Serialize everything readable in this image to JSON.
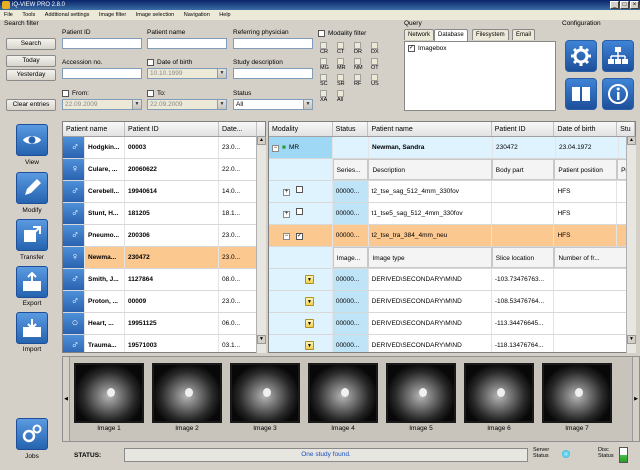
{
  "window": {
    "title": "iQ-VIEW PRO 2.8.0"
  },
  "menu": [
    "File",
    "Tools",
    "Additional settings",
    "Image filter",
    "Image selection",
    "Navigation",
    "Help"
  ],
  "search": {
    "group_label": "Search filter",
    "buttons": {
      "search": "Search",
      "today": "Today",
      "yesterday": "Yesterday",
      "clear": "Clear entries"
    },
    "labels": {
      "patient_id": "Patient ID",
      "patient_name": "Patient name",
      "referring_physician": "Referring physician",
      "accession_no": "Accession no.",
      "date_of_birth": "Date of birth",
      "study_description": "Study description",
      "from": "From:",
      "to": "To:",
      "status": "Status"
    },
    "values": {
      "date_of_birth": "10.10.1999",
      "from_date": "22.09.2009",
      "to_date": "22.09.2009",
      "status": "All"
    },
    "modality_filter": {
      "label": "Modality filter",
      "items": [
        "CR",
        "CT",
        "DR",
        "DX",
        "MG",
        "MR",
        "NM",
        "OT",
        "SC",
        "SR",
        "RF",
        "US",
        "XA",
        "All"
      ]
    }
  },
  "query": {
    "group_label": "Query",
    "tabs": [
      "Network",
      "Database",
      "Filesystem",
      "Email"
    ],
    "active_tab": "Database",
    "list_items": [
      "Imagebox"
    ]
  },
  "configuration": {
    "group_label": "Configuration"
  },
  "nav": {
    "view": "View",
    "modify": "Modify",
    "transfer": "Transfer",
    "export": "Export",
    "import": "Import",
    "jobs": "Jobs"
  },
  "patients": {
    "columns": [
      "Patient name",
      "Patient ID",
      "Date..."
    ],
    "rows": [
      {
        "name": "Hodgkin...",
        "id": "00003",
        "date": "23.0...",
        "gender": "male"
      },
      {
        "name": "Culare, ...",
        "id": "20060622",
        "date": "22.0...",
        "gender": "female"
      },
      {
        "name": "Cerebell...",
        "id": "19940614",
        "date": "14.0...",
        "gender": "male"
      },
      {
        "name": "Stunt, H...",
        "id": "181205",
        "date": "18.1...",
        "gender": "male"
      },
      {
        "name": "Pneumo...",
        "id": "200306",
        "date": "23.0...",
        "gender": "male"
      },
      {
        "name": "Newma...",
        "id": "230472",
        "date": "23.0...",
        "gender": "female",
        "selected": true
      },
      {
        "name": "Smith, J...",
        "id": "1127864",
        "date": "08.0...",
        "gender": "male"
      },
      {
        "name": "Proton, ...",
        "id": "00009",
        "date": "23.0...",
        "gender": "male"
      },
      {
        "name": "Heart, ...",
        "id": "19951125",
        "date": "06.0...",
        "gender": "neutral"
      },
      {
        "name": "Trauma...",
        "id": "19571003",
        "date": "03.1...",
        "gender": "male"
      }
    ]
  },
  "study": {
    "header": [
      "Modality",
      "Status",
      "Patient name",
      "Patient ID",
      "Date of birth",
      "Stu"
    ],
    "patient_row": {
      "modality": "MR",
      "name": "Newman, Sandra",
      "id": "230472",
      "dob": "23.04.1972"
    },
    "series_header": [
      "Series...",
      "Description",
      "Body part",
      "Patient position",
      "Proto"
    ],
    "series": [
      {
        "num": "00000...",
        "desc": "t2_tse_sag_512_4mm_330fov",
        "position": "HFS",
        "checked": false,
        "expanded": false
      },
      {
        "num": "00000...",
        "desc": "t1_tse5_sag_512_4mm_330fov",
        "position": "HFS",
        "checked": false,
        "expanded": false
      },
      {
        "num": "00000...",
        "desc": "t2_tse_tra_384_4mm_neu",
        "position": "HFS",
        "checked": true,
        "expanded": true
      }
    ],
    "image_header": [
      "Image...",
      "Image type",
      "Slice location",
      "Number of fr..."
    ],
    "images": [
      {
        "num": "00000...",
        "type": "DERIVED\\SECONDARY\\M\\ND",
        "slice": "-103.73476763..."
      },
      {
        "num": "00000...",
        "type": "DERIVED\\SECONDARY\\M\\ND",
        "slice": "-108.53476764..."
      },
      {
        "num": "00000...",
        "type": "DERIVED\\SECONDARY\\M\\ND",
        "slice": "-113.34476645..."
      },
      {
        "num": "00000...",
        "type": "DERIVED\\SECONDARY\\M\\ND",
        "slice": "-118.13476764..."
      }
    ]
  },
  "thumbnails": [
    "Image 1",
    "Image 2",
    "Image 3",
    "Image 4",
    "Image 5",
    "Image 6",
    "Image 7"
  ],
  "status": {
    "label": "STATUS:",
    "message": "One study found.",
    "server_status": "Server\nStatus",
    "disc_status": "Disc\nStatus"
  }
}
